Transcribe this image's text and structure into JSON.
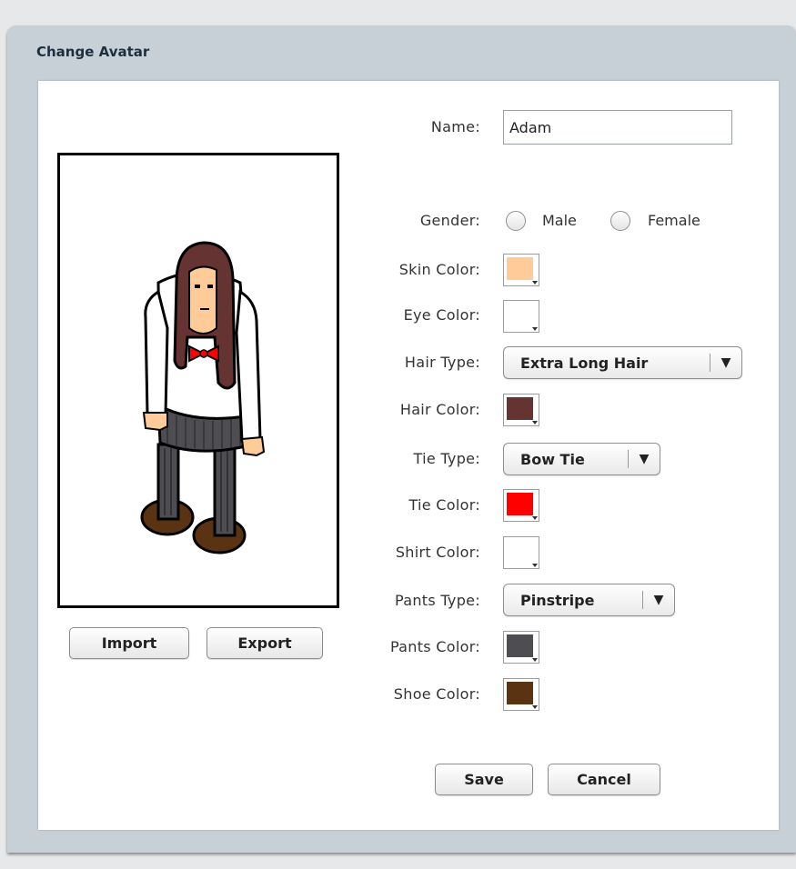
{
  "dialog": {
    "title": "Change Avatar"
  },
  "preview": {
    "import_label": "Import",
    "export_label": "Export"
  },
  "form": {
    "name_label": "Name:",
    "name_value": "Adam",
    "gender_label": "Gender:",
    "gender_options": [
      "Male",
      "Female"
    ],
    "skin_label": "Skin Color:",
    "eye_label": "Eye Color:",
    "hair_type_label": "Hair Type:",
    "hair_type_value": "Extra Long Hair",
    "hair_color_label": "Hair Color:",
    "tie_type_label": "Tie Type:",
    "tie_type_value": "Bow Tie",
    "tie_color_label": "Tie Color:",
    "shirt_color_label": "Shirt Color:",
    "pants_type_label": "Pants Type:",
    "pants_type_value": "Pinstripe",
    "pants_color_label": "Pants Color:",
    "shoe_color_label": "Shoe Color:",
    "dropdown_arrow": "▼"
  },
  "colors": {
    "skin": "#ffcc99",
    "eye": "#ffffff",
    "hair": "#663333",
    "tie": "#ff0000",
    "shirt": "#ffffff",
    "pants": "#4d4d52",
    "shoe": "#5a3313"
  },
  "actions": {
    "save_label": "Save",
    "cancel_label": "Cancel"
  }
}
